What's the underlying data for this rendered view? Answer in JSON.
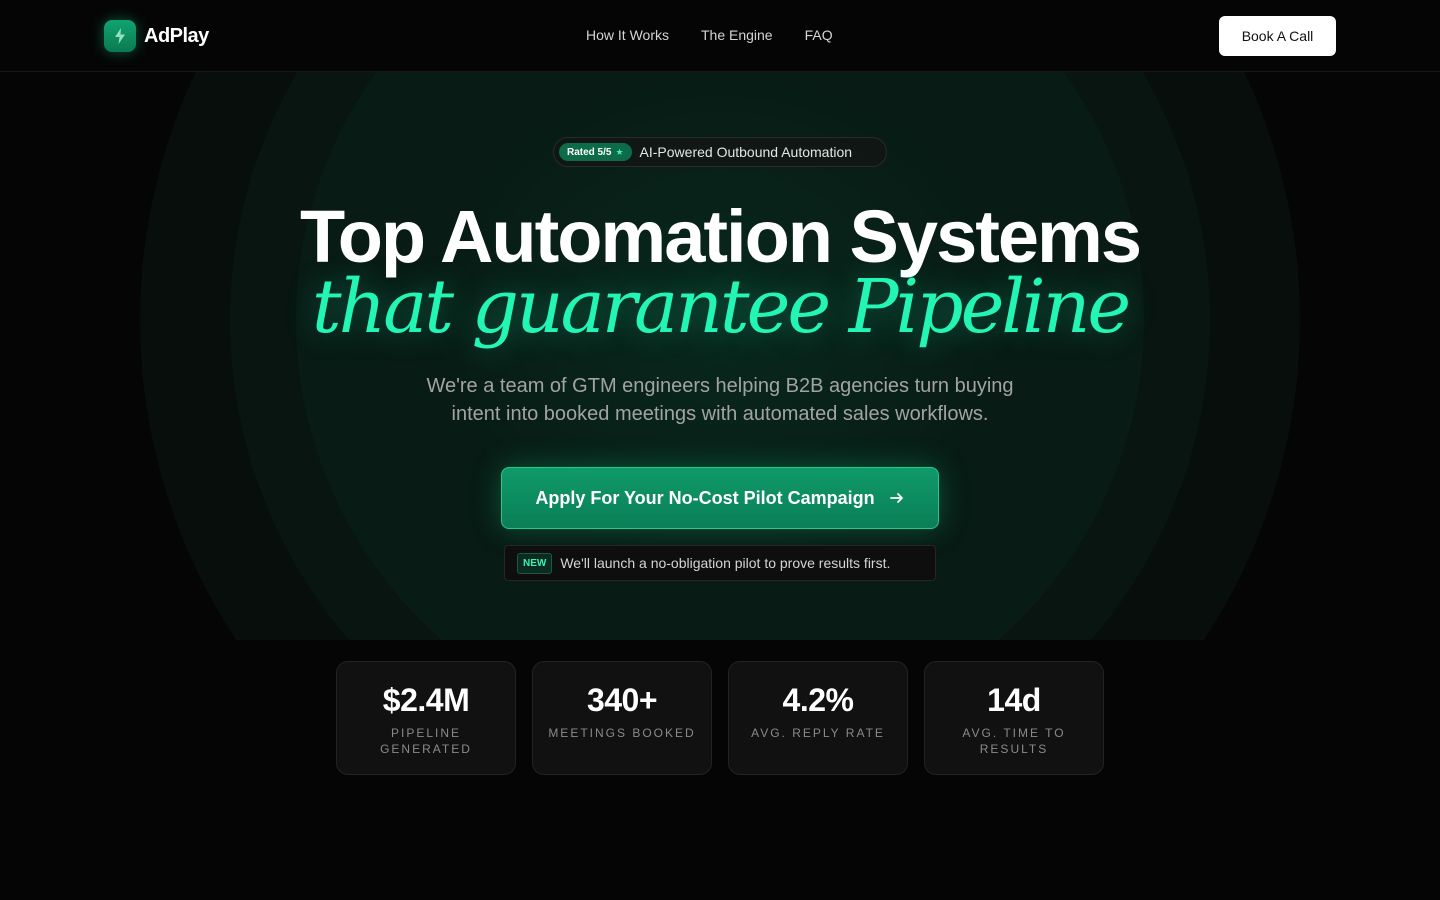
{
  "brand": {
    "name": "AdPlay",
    "icon": "lightning-bolt-icon"
  },
  "nav": {
    "items": [
      {
        "label": "How It Works"
      },
      {
        "label": "The Engine"
      },
      {
        "label": "FAQ"
      }
    ],
    "cta_label": "Book A Call"
  },
  "hero": {
    "badge_rating": "Rated 5/5",
    "badge_star": "★",
    "badge_text": "AI-Powered Outbound Automation",
    "title_line1": "Top Automation Systems",
    "title_line2": "that guarantee Pipeline",
    "subtitle": "We're a team of GTM engineers helping B2B agencies turn buying intent into booked meetings with automated sales workflows.",
    "cta_label": "Apply For Your No-Cost Pilot Campaign",
    "note_tag": "NEW",
    "note_text": "We'll launch a no-obligation pilot to prove results first."
  },
  "stats": [
    {
      "value": "$2.4M",
      "label": "PIPELINE GENERATED"
    },
    {
      "value": "340+",
      "label": "MEETINGS BOOKED"
    },
    {
      "value": "4.2%",
      "label": "AVG. REPLY RATE"
    },
    {
      "value": "14d",
      "label": "AVG. TIME TO RESULTS"
    }
  ],
  "colors": {
    "accent": "#22f5b4",
    "button": "#0f9a6a",
    "background": "#050505"
  }
}
